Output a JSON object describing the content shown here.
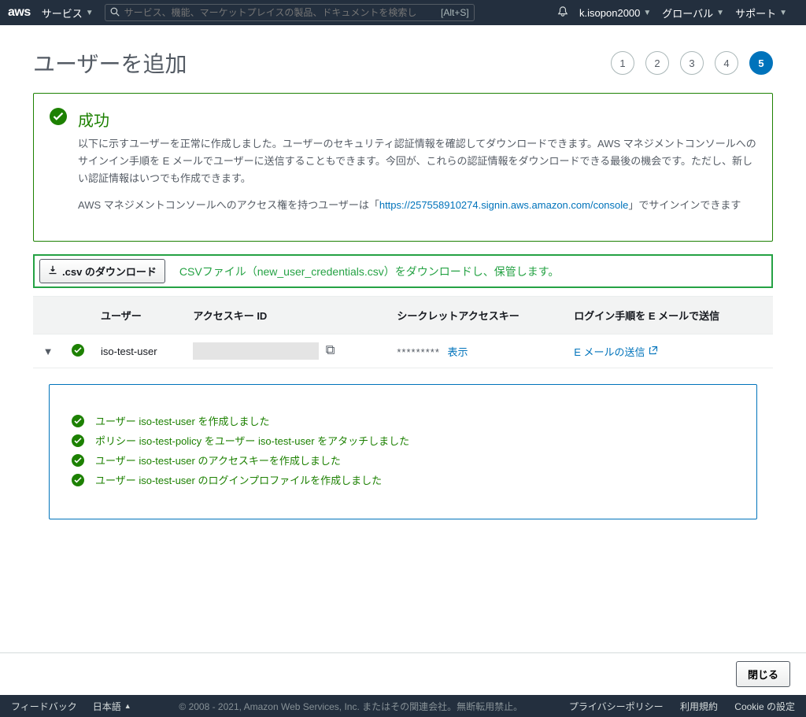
{
  "topnav": {
    "services": "サービス",
    "search_placeholder": "サービス、機能、マーケットプレイスの製品、ドキュメントを検索し",
    "search_hint": "[Alt+S]",
    "account": "k.isopon2000",
    "region": "グローバル",
    "support": "サポート"
  },
  "page_title": "ユーザーを追加",
  "steps": [
    "1",
    "2",
    "3",
    "4",
    "5"
  ],
  "active_step": 5,
  "success": {
    "title": "成功",
    "p1": "以下に示すユーザーを正常に作成しました。ユーザーのセキュリティ認証情報を確認してダウンロードできます。AWS マネジメントコンソールへのサインイン手順を E メールでユーザーに送信することもできます。今回が、これらの認証情報をダウンロードできる最後の機会です。ただし、新しい認証情報はいつでも作成できます。",
    "p2a": "AWS マネジメントコンソールへのアクセス権を持つユーザーは「",
    "link": "https://257558910274.signin.aws.amazon.com/console",
    "p2b": "」でサインインできます"
  },
  "csv": {
    "button": ".csv のダウンロード",
    "note": "CSVファイル（new_user_credentials.csv）をダウンロードし、保管します。"
  },
  "table": {
    "col_user": "ユーザー",
    "col_access": "アクセスキー ID",
    "col_secret": "シークレットアクセスキー",
    "col_email": "ログイン手順を E メールで送信",
    "row": {
      "user": "iso-test-user",
      "secret_masked": "*********",
      "show": "表示",
      "email_action": "E メールの送信"
    }
  },
  "details": [
    "ユーザー iso-test-user を作成しました",
    "ポリシー iso-test-policy をユーザー iso-test-user をアタッチしました",
    "ユーザー iso-test-user のアクセスキーを作成しました",
    "ユーザー iso-test-user のログインプロファイルを作成しました"
  ],
  "close_button": "閉じる",
  "footer": {
    "feedback": "フィードバック",
    "language": "日本語",
    "copyright": "© 2008 - 2021, Amazon Web Services, Inc. またはその関連会社。無断転用禁止。",
    "privacy": "プライバシーポリシー",
    "terms": "利用規約",
    "cookie": "Cookie の設定"
  }
}
